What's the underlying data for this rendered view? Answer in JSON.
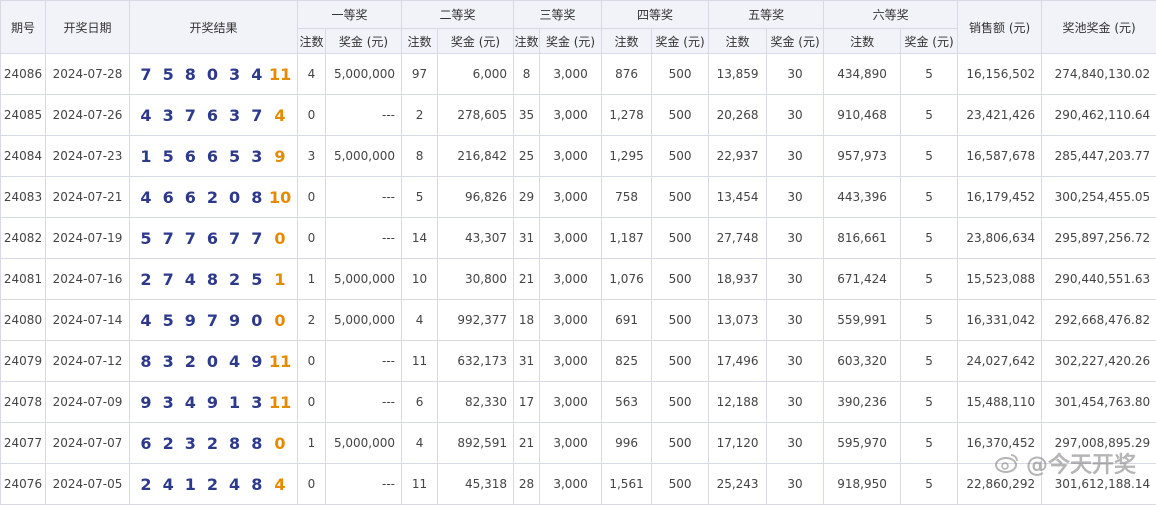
{
  "headers": {
    "issue": "期号",
    "date": "开奖日期",
    "result": "开奖结果",
    "prize1": "一等奖",
    "prize2": "二等奖",
    "prize3": "三等奖",
    "prize4": "四等奖",
    "prize5": "五等奖",
    "prize6": "六等奖",
    "sales": "销售额 (元)",
    "pool": "奖池奖金 (元)",
    "count": "注数",
    "amount": "奖金 (元)"
  },
  "rows": [
    {
      "issue": "24086",
      "date": "2024-07-28",
      "balls": [
        "7",
        "5",
        "8",
        "0",
        "3",
        "4"
      ],
      "special": "11",
      "p1c": "4",
      "p1a": "5,000,000",
      "p2c": "97",
      "p2a": "6,000",
      "p3c": "8",
      "p3a": "3,000",
      "p4c": "876",
      "p4a": "500",
      "p5c": "13,859",
      "p5a": "30",
      "p6c": "434,890",
      "p6a": "5",
      "sales": "16,156,502",
      "pool": "274,840,130.02"
    },
    {
      "issue": "24085",
      "date": "2024-07-26",
      "balls": [
        "4",
        "3",
        "7",
        "6",
        "3",
        "7"
      ],
      "special": "4",
      "p1c": "0",
      "p1a": "---",
      "p2c": "2",
      "p2a": "278,605",
      "p3c": "35",
      "p3a": "3,000",
      "p4c": "1,278",
      "p4a": "500",
      "p5c": "20,268",
      "p5a": "30",
      "p6c": "910,468",
      "p6a": "5",
      "sales": "23,421,426",
      "pool": "290,462,110.64"
    },
    {
      "issue": "24084",
      "date": "2024-07-23",
      "balls": [
        "1",
        "5",
        "6",
        "6",
        "5",
        "3"
      ],
      "special": "9",
      "p1c": "3",
      "p1a": "5,000,000",
      "p2c": "8",
      "p2a": "216,842",
      "p3c": "25",
      "p3a": "3,000",
      "p4c": "1,295",
      "p4a": "500",
      "p5c": "22,937",
      "p5a": "30",
      "p6c": "957,973",
      "p6a": "5",
      "sales": "16,587,678",
      "pool": "285,447,203.77"
    },
    {
      "issue": "24083",
      "date": "2024-07-21",
      "balls": [
        "4",
        "6",
        "6",
        "2",
        "0",
        "8"
      ],
      "special": "10",
      "p1c": "0",
      "p1a": "---",
      "p2c": "5",
      "p2a": "96,826",
      "p3c": "29",
      "p3a": "3,000",
      "p4c": "758",
      "p4a": "500",
      "p5c": "13,454",
      "p5a": "30",
      "p6c": "443,396",
      "p6a": "5",
      "sales": "16,179,452",
      "pool": "300,254,455.05"
    },
    {
      "issue": "24082",
      "date": "2024-07-19",
      "balls": [
        "5",
        "7",
        "7",
        "6",
        "7",
        "7"
      ],
      "special": "0",
      "p1c": "0",
      "p1a": "---",
      "p2c": "14",
      "p2a": "43,307",
      "p3c": "31",
      "p3a": "3,000",
      "p4c": "1,187",
      "p4a": "500",
      "p5c": "27,748",
      "p5a": "30",
      "p6c": "816,661",
      "p6a": "5",
      "sales": "23,806,634",
      "pool": "295,897,256.72"
    },
    {
      "issue": "24081",
      "date": "2024-07-16",
      "balls": [
        "2",
        "7",
        "4",
        "8",
        "2",
        "5"
      ],
      "special": "1",
      "p1c": "1",
      "p1a": "5,000,000",
      "p2c": "10",
      "p2a": "30,800",
      "p3c": "21",
      "p3a": "3,000",
      "p4c": "1,076",
      "p4a": "500",
      "p5c": "18,937",
      "p5a": "30",
      "p6c": "671,424",
      "p6a": "5",
      "sales": "15,523,088",
      "pool": "290,440,551.63"
    },
    {
      "issue": "24080",
      "date": "2024-07-14",
      "balls": [
        "4",
        "5",
        "9",
        "7",
        "9",
        "0"
      ],
      "special": "0",
      "p1c": "2",
      "p1a": "5,000,000",
      "p2c": "4",
      "p2a": "992,377",
      "p3c": "18",
      "p3a": "3,000",
      "p4c": "691",
      "p4a": "500",
      "p5c": "13,073",
      "p5a": "30",
      "p6c": "559,991",
      "p6a": "5",
      "sales": "16,331,042",
      "pool": "292,668,476.82"
    },
    {
      "issue": "24079",
      "date": "2024-07-12",
      "balls": [
        "8",
        "3",
        "2",
        "0",
        "4",
        "9"
      ],
      "special": "11",
      "p1c": "0",
      "p1a": "---",
      "p2c": "11",
      "p2a": "632,173",
      "p3c": "31",
      "p3a": "3,000",
      "p4c": "825",
      "p4a": "500",
      "p5c": "17,496",
      "p5a": "30",
      "p6c": "603,320",
      "p6a": "5",
      "sales": "24,027,642",
      "pool": "302,227,420.26"
    },
    {
      "issue": "24078",
      "date": "2024-07-09",
      "balls": [
        "9",
        "3",
        "4",
        "9",
        "1",
        "3"
      ],
      "special": "11",
      "p1c": "0",
      "p1a": "---",
      "p2c": "6",
      "p2a": "82,330",
      "p3c": "17",
      "p3a": "3,000",
      "p4c": "563",
      "p4a": "500",
      "p5c": "12,188",
      "p5a": "30",
      "p6c": "390,236",
      "p6a": "5",
      "sales": "15,488,110",
      "pool": "301,454,763.80"
    },
    {
      "issue": "24077",
      "date": "2024-07-07",
      "balls": [
        "6",
        "2",
        "3",
        "2",
        "8",
        "8"
      ],
      "special": "0",
      "p1c": "1",
      "p1a": "5,000,000",
      "p2c": "4",
      "p2a": "892,591",
      "p3c": "21",
      "p3a": "3,000",
      "p4c": "996",
      "p4a": "500",
      "p5c": "17,120",
      "p5a": "30",
      "p6c": "595,970",
      "p6a": "5",
      "sales": "16,370,452",
      "pool": "297,008,895.29"
    },
    {
      "issue": "24076",
      "date": "2024-07-05",
      "balls": [
        "2",
        "4",
        "1",
        "2",
        "4",
        "8"
      ],
      "special": "4",
      "p1c": "0",
      "p1a": "---",
      "p2c": "11",
      "p2a": "45,318",
      "p3c": "28",
      "p3a": "3,000",
      "p4c": "1,561",
      "p4a": "500",
      "p5c": "25,243",
      "p5a": "30",
      "p6c": "918,950",
      "p6a": "5",
      "sales": "22,860,292",
      "pool": "301,612,188.14"
    }
  ],
  "watermark": {
    "text": "@今天开奖",
    "icon": "weibo-logo-icon"
  },
  "colors": {
    "ball": "#2d3a8c",
    "special_ball": "#e68a00",
    "header_bg": "#f2f3f8"
  }
}
